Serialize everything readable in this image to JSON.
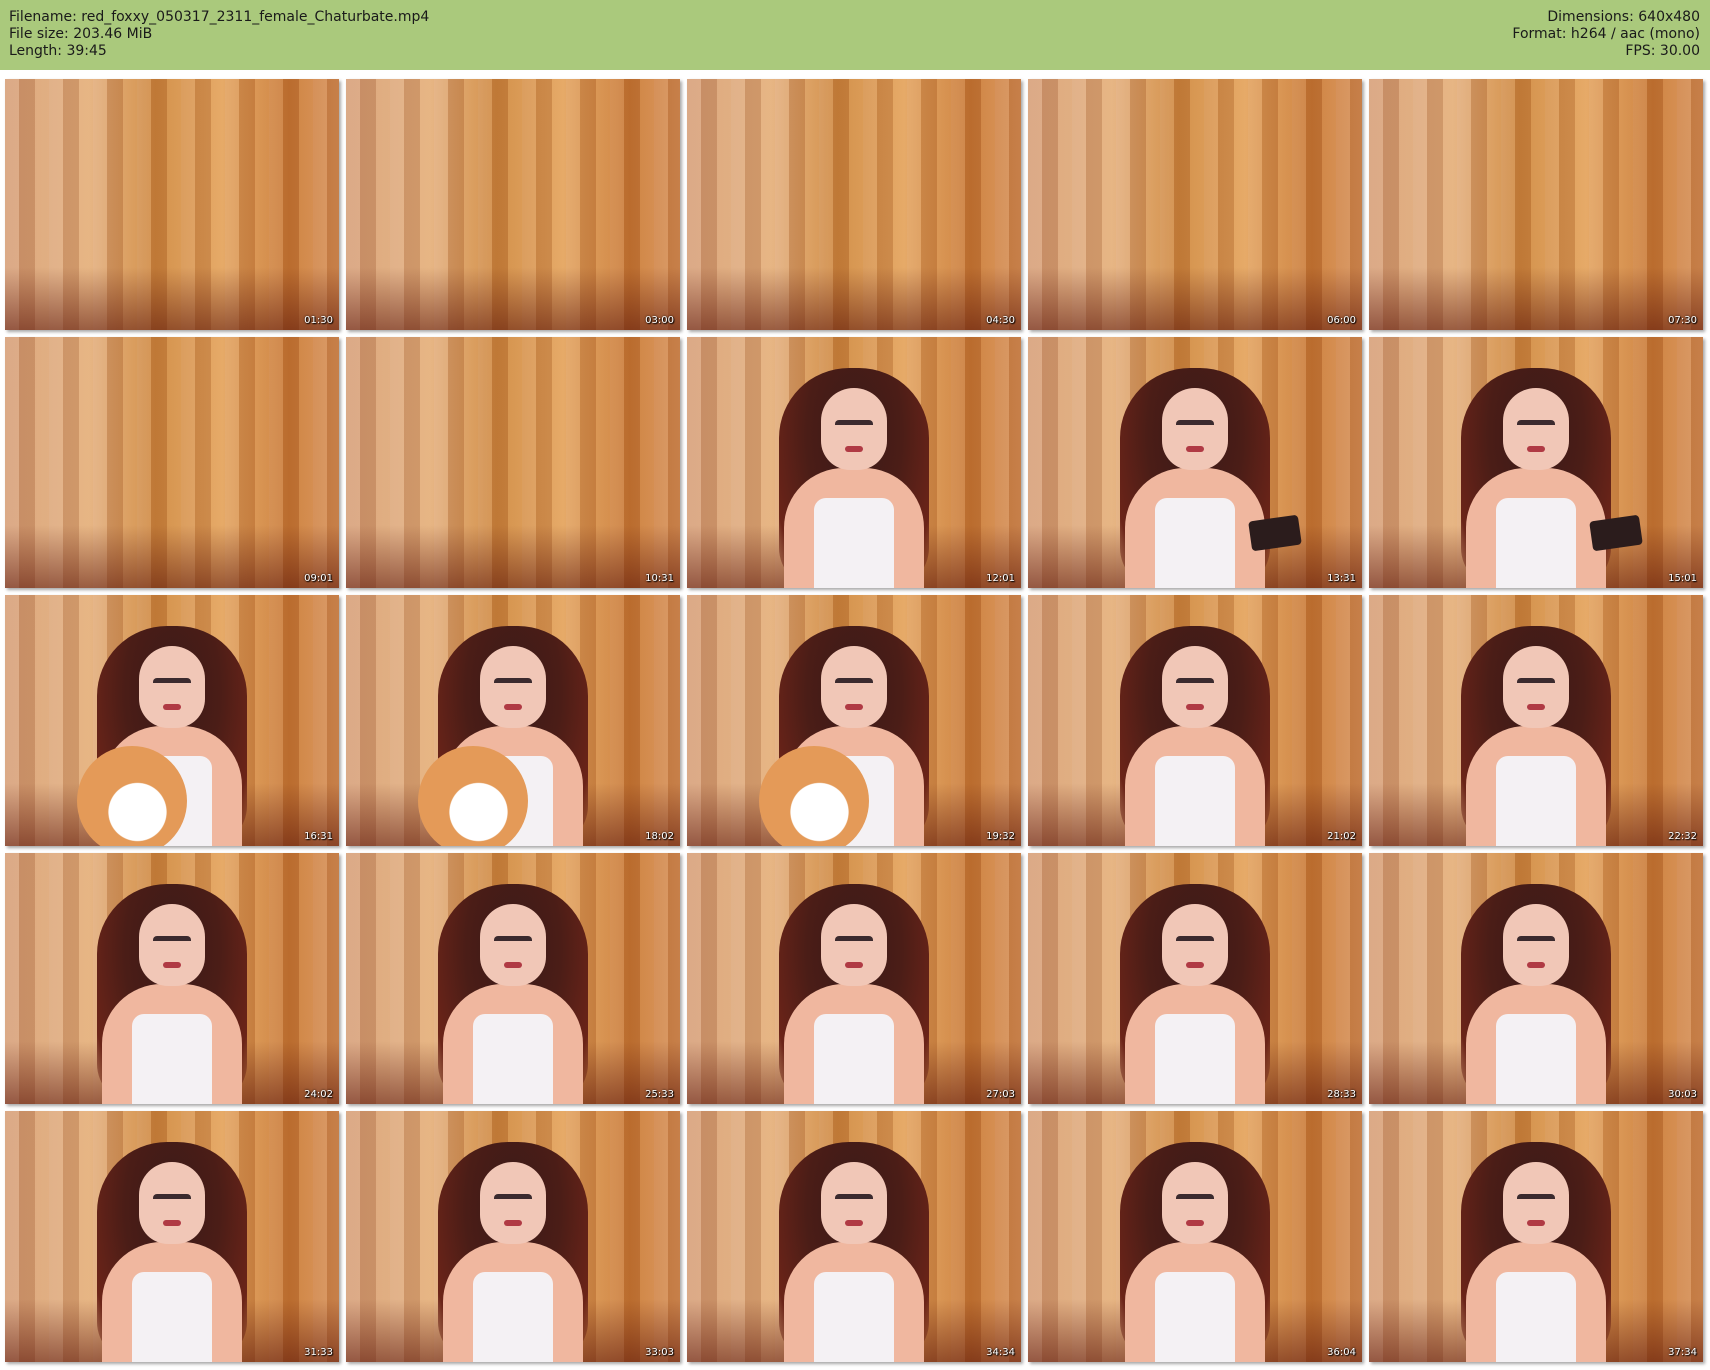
{
  "header": {
    "filename": "Filename: red_foxxy_050317_2311_female_Chaturbate.mp4",
    "filesize": "File size: 203.46 MiB",
    "length": "Length: 39:45",
    "dimensions": "Dimensions: 640x480",
    "format": "Format: h264 / aac (mono)",
    "fps": "FPS: 30.00",
    "background_color": "#aac97c"
  },
  "thumbnails": [
    {
      "time": "01:30",
      "scene": "curtain"
    },
    {
      "time": "03:00",
      "scene": "curtain"
    },
    {
      "time": "04:30",
      "scene": "curtain"
    },
    {
      "time": "06:00",
      "scene": "curtain"
    },
    {
      "time": "07:30",
      "scene": "curtain"
    },
    {
      "time": "09:01",
      "scene": "curtain"
    },
    {
      "time": "10:31",
      "scene": "curtain"
    },
    {
      "time": "12:01",
      "scene": "person"
    },
    {
      "time": "13:31",
      "scene": "person-phone"
    },
    {
      "time": "15:01",
      "scene": "person-phone"
    },
    {
      "time": "16:31",
      "scene": "person-toy"
    },
    {
      "time": "18:02",
      "scene": "person-toy"
    },
    {
      "time": "19:32",
      "scene": "person-toy"
    },
    {
      "time": "21:02",
      "scene": "person"
    },
    {
      "time": "22:32",
      "scene": "person"
    },
    {
      "time": "24:02",
      "scene": "person"
    },
    {
      "time": "25:33",
      "scene": "person"
    },
    {
      "time": "27:03",
      "scene": "person"
    },
    {
      "time": "28:33",
      "scene": "person"
    },
    {
      "time": "30:03",
      "scene": "person"
    },
    {
      "time": "31:33",
      "scene": "person"
    },
    {
      "time": "33:03",
      "scene": "person"
    },
    {
      "time": "34:34",
      "scene": "person"
    },
    {
      "time": "36:04",
      "scene": "person"
    },
    {
      "time": "37:34",
      "scene": "person"
    }
  ]
}
